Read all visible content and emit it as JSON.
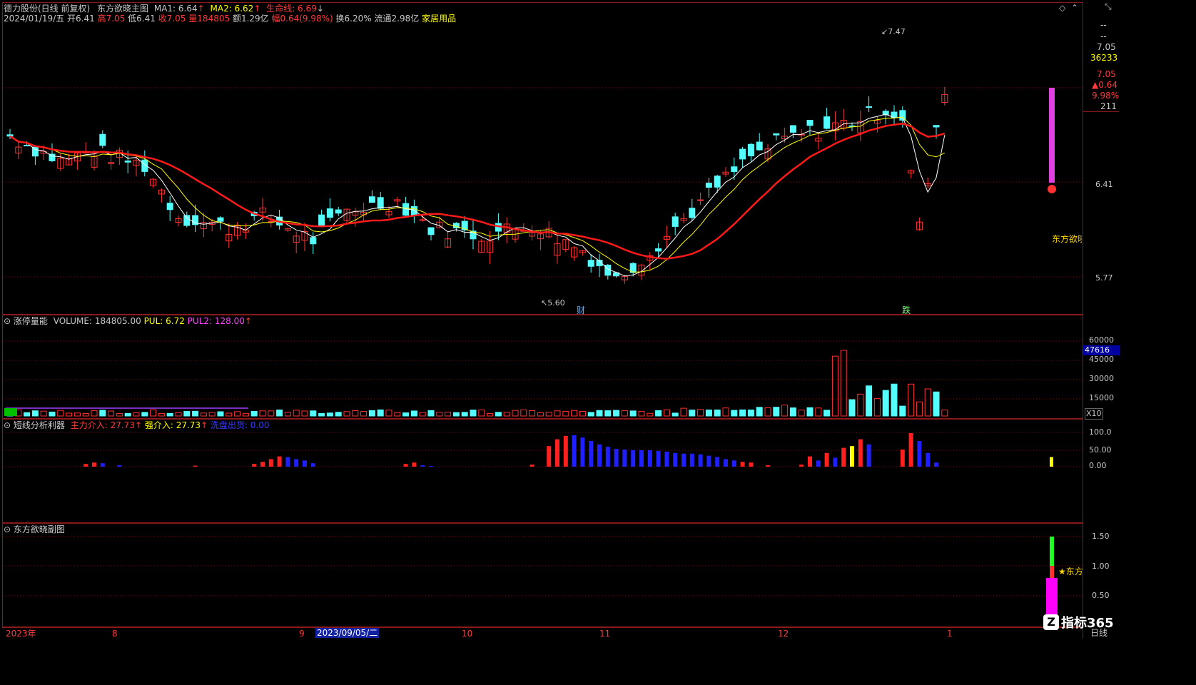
{
  "header": {
    "stock": "德力股份(日线 前复权)",
    "indicator": "东方欲晓主图",
    "ma1_label": "MA1: 6.64",
    "ma2_label": "MA2: 6.62",
    "life_label": "生命线: 6.69",
    "date": "2024/01/19/五",
    "open": "开6.41",
    "high": "高7.05",
    "low": "低6.41",
    "close": "收7.05",
    "volume": "量184805",
    "amount": "额1.29亿",
    "change": "幅0.64(9.98%)",
    "turnover": "换6.20%",
    "float": "流通2.98亿",
    "sector": "家居用品"
  },
  "right_info": {
    "dash1": "--",
    "dash2": "--",
    "price1": "7.05",
    "vol": "36233",
    "price2": "7.05",
    "delta": "▲0.64",
    "pct": "9.98%",
    "num": "211"
  },
  "main_axis": [
    "6.41",
    "5.77"
  ],
  "annotations": {
    "high": "7.47",
    "low": "5.60",
    "cai": "财",
    "die": "跌",
    "dongfang": "东方欲晓"
  },
  "volume_panel": {
    "title": "涨停量能",
    "volume_label": "VOLUME: 184805.00",
    "pul": "PUL: 6.72",
    "pul2": "PUL2: 128.00",
    "axis": [
      "60000",
      "45000",
      "30000",
      "15000"
    ],
    "current": "47616",
    "x10": "X10"
  },
  "short_panel": {
    "title": "短线分析利器",
    "main_in": "主力介入: 27.73",
    "strong_in": "强介入: 27.73",
    "wash": "洗盘出货: 0.00",
    "axis": [
      "100.0",
      "50.00",
      "0.00"
    ]
  },
  "sub_panel": {
    "title": "东方欲晓副图",
    "axis": [
      "1.50",
      "1.00",
      "0.50"
    ],
    "star_label": "★东方"
  },
  "timeline": {
    "year": "2023年",
    "m8": "8",
    "m9": "9",
    "selected_date": "2023/09/05/二",
    "m10": "10",
    "m11": "11",
    "m12": "12",
    "m1": "1"
  },
  "footer": {
    "day": "日线",
    "brand": "指标365"
  },
  "window_icons": [
    "diamond-icon",
    "scroll-up-icon",
    "restore-icon"
  ],
  "colors": {
    "up": "#ff3232",
    "down": "#54ffff",
    "ma1": "#ffffff",
    "ma2": "#ffff00",
    "life": "#ff1a1a",
    "bg": "#000000",
    "grid": "#6a1010"
  }
}
